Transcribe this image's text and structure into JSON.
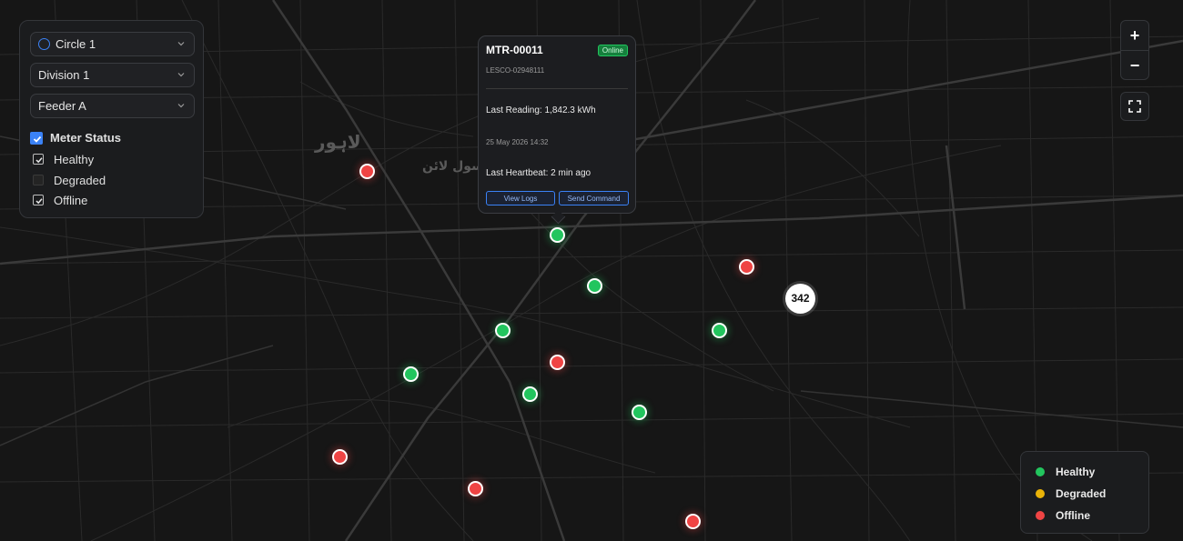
{
  "filters": {
    "circle": "Circle 1",
    "division": "Division 1",
    "feeder": "Feeder A",
    "meter_status_label": "Meter Status",
    "status_options": [
      {
        "label": "Healthy",
        "checked": true
      },
      {
        "label": "Degraded",
        "checked": false
      },
      {
        "label": "Offline",
        "checked": true
      }
    ]
  },
  "map_labels": {
    "label_a": "لاہور",
    "label_b": "رسول لائن"
  },
  "popup": {
    "meter_id": "MTR-00011",
    "status_badge": "Online",
    "account": "LESCO-02948111",
    "last_reading": "Last Reading: 1,842.3 kWh",
    "date": "25 May 2026 14:32",
    "last_heartbeat": "Last Heartbeat: 2 min ago",
    "view_logs": "View Logs",
    "send_command": "Send Command"
  },
  "cluster_count": "342",
  "controls": {
    "zoom_in": "+",
    "zoom_out": "−"
  },
  "legend": {
    "items": [
      {
        "label": "Healthy",
        "color": "#22c55e"
      },
      {
        "label": "Degraded",
        "color": "#eab308"
      },
      {
        "label": "Offline",
        "color": "#ef4444"
      }
    ]
  },
  "markers": [
    {
      "status": "offline",
      "color": "#ef4444"
    },
    {
      "status": "healthy",
      "color": "#22c55e"
    },
    {
      "status": "healthy",
      "color": "#22c55e"
    },
    {
      "status": "offline",
      "color": "#ef4444"
    },
    {
      "status": "healthy",
      "color": "#22c55e"
    },
    {
      "status": "healthy",
      "color": "#22c55e"
    },
    {
      "status": "offline",
      "color": "#ef4444"
    },
    {
      "status": "healthy",
      "color": "#22c55e"
    },
    {
      "status": "healthy",
      "color": "#22c55e"
    },
    {
      "status": "healthy",
      "color": "#22c55e"
    },
    {
      "status": "offline",
      "color": "#ef4444"
    },
    {
      "status": "offline",
      "color": "#ef4444"
    },
    {
      "status": "offline",
      "color": "#ef4444"
    }
  ]
}
